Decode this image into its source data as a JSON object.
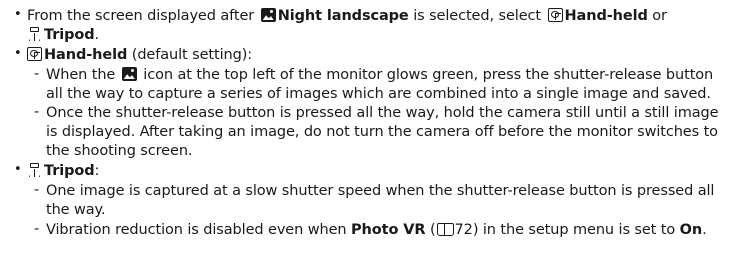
{
  "items": {
    "b1": {
      "pre": "From the screen displayed after",
      "night": "Night landscape",
      "mid": "is selected, select",
      "hand": "Hand-held",
      "or": "or",
      "tripod": "Tripod",
      "end": "."
    },
    "b2": {
      "hand": "Hand-held",
      "rest": "(default setting):",
      "d1a_pre": "When the",
      "d1a_post": "icon at the top left of the monitor glows green, press the shutter-release button",
      "d1b": "all the way to capture a series of images which are combined into a single image and saved.",
      "d2a": "Once the shutter-release button is pressed all the way, hold the camera still until a still image",
      "d2b": "is displayed. After taking an image, do not turn the camera off before the monitor switches to",
      "d2c": "the shooting screen."
    },
    "b3": {
      "tripod": "Tripod",
      "colon": ":",
      "d1a": "One image is captured at a slow shutter speed when the shutter-release button is pressed all",
      "d1b": "the way.",
      "d2_pre": "Vibration reduction is disabled even when",
      "d2_photovr": "Photo VR",
      "d2_paren_open": "(",
      "d2_page": "72",
      "d2_mid": ") in the setup menu is set to",
      "d2_on": "On",
      "d2_end": "."
    }
  },
  "glyphs": {
    "bullet": "•",
    "dash": "-"
  },
  "icons": [
    "night-landscape-icon",
    "hand-held-icon",
    "tripod-icon",
    "book-reference-icon"
  ]
}
